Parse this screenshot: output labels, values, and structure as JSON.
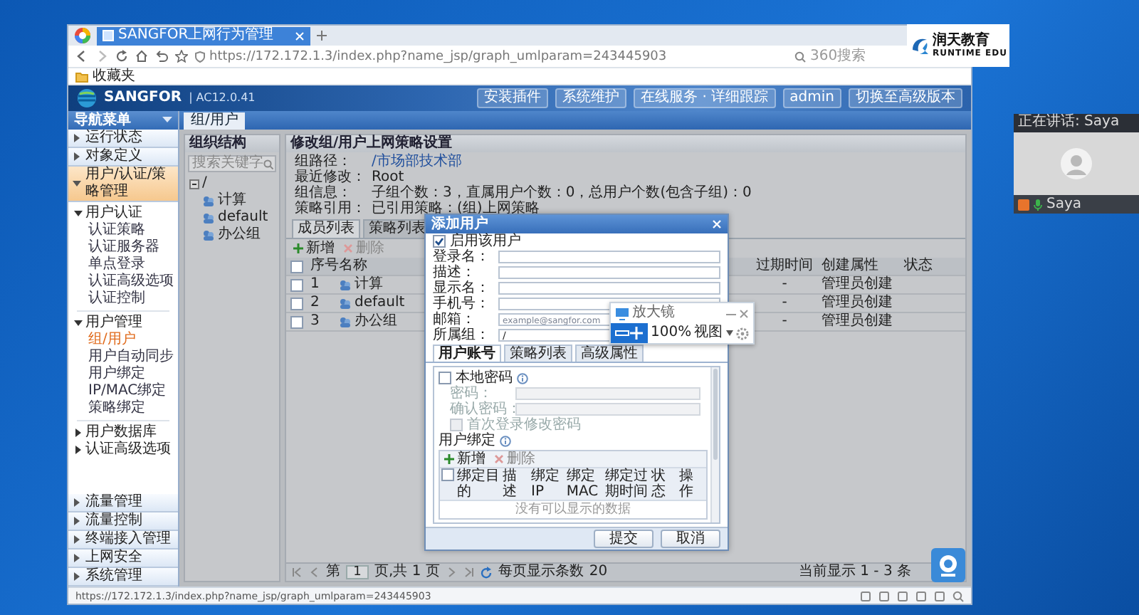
{
  "browser": {
    "tab_title": "SANGFOR上网行为管理",
    "url": "https://172.172.1.3/index.php?name_jsp/graph_umlparam=243445903",
    "search_placeholder": "360搜索",
    "bookmark": "收藏夹",
    "status_url": "https://172.172.1.3/index.php?name_jsp/graph_umlparam=243445903"
  },
  "app_header": {
    "brand": "SANGFOR",
    "version": "| AC12.0.41",
    "buttons": [
      "安装插件",
      "系统维护",
      "在线服务 · 详细跟踪",
      "admin",
      "切换至高级版本"
    ]
  },
  "nav": {
    "title": "导航菜单",
    "sections": [
      {
        "label": "运行状态",
        "expanded": false
      },
      {
        "label": "对象定义",
        "expanded": false
      },
      {
        "label": "用户/认证/策略管理",
        "expanded": true,
        "groups": [
          {
            "label": "用户认证",
            "expanded": true,
            "items": [
              {
                "label": "认证策略",
                "selected": false
              },
              {
                "label": "认证服务器",
                "selected": false
              },
              {
                "label": "单点登录",
                "selected": false
              },
              {
                "label": "认证高级选项",
                "selected": false
              },
              {
                "label": "认证控制",
                "selected": false
              }
            ]
          },
          {
            "label": "用户管理",
            "expanded": true,
            "items": [
              {
                "label": "组/用户",
                "selected": true
              },
              {
                "label": "用户自动同步",
                "selected": false
              },
              {
                "label": "用户绑定",
                "selected": false
              },
              {
                "label": "IP/MAC绑定",
                "selected": false
              },
              {
                "label": "策略绑定",
                "selected": false
              }
            ]
          },
          {
            "label": "用户数据库",
            "expanded": false
          },
          {
            "label": "认证高级选项",
            "expanded": false
          }
        ]
      },
      {
        "label": "流量管理",
        "expanded": false
      },
      {
        "label": "流量控制",
        "expanded": false
      },
      {
        "label": "终端接入管理",
        "expanded": false
      },
      {
        "label": "上网安全",
        "expanded": false
      },
      {
        "label": "系统管理",
        "expanded": false
      }
    ]
  },
  "page_tab": "组/用户",
  "org": {
    "title": "组织结构",
    "search_placeholder": "搜索关键字",
    "root": {
      "label": "/",
      "expanded": true,
      "children": [
        {
          "label": "计算"
        },
        {
          "label": "default"
        },
        {
          "label": "办公组"
        }
      ]
    }
  },
  "panel": {
    "title": "修改组/用户上网策略设置",
    "info": [
      {
        "label": "组路径：",
        "value": "/市场部技术部",
        "kind": "link"
      },
      {
        "label": "最近修改：",
        "value": "Root",
        "kind": "text"
      },
      {
        "label": "组信息：",
        "value": "子组个数：3，直属用户个数：0，总用户个数(包含子组)：0",
        "kind": "text"
      },
      {
        "label": "策略引用：",
        "value": "已引用策略：(组)上网策略",
        "kind": "text"
      }
    ],
    "tabs": [
      {
        "label": "成员列表",
        "selected": true
      },
      {
        "label": "策略列表",
        "selected": false
      }
    ],
    "toolbar": [
      {
        "label": "新增",
        "kind": "add",
        "disabled": false
      },
      {
        "label": "删除",
        "kind": "delete",
        "disabled": true
      }
    ],
    "select_all": false,
    "columns": [
      "序号",
      "名称",
      "过期时间",
      "创建属性",
      "状态"
    ],
    "rows": [
      {
        "index": "1",
        "name": "计算",
        "expiry": "-",
        "created_by": "管理员创建",
        "checked": false
      },
      {
        "index": "2",
        "name": "default",
        "expiry": "-",
        "created_by": "管理员创建",
        "checked": false
      },
      {
        "index": "3",
        "name": "办公组",
        "expiry": "-",
        "created_by": "管理员创建",
        "checked": false
      }
    ],
    "pager": {
      "page_label": "第",
      "page": "1",
      "page_total": "页,共 1 页",
      "per_page_label": "每页显示条数",
      "per_page": "20",
      "summary": "当前显示 1 - 3 条"
    }
  },
  "dialog": {
    "title": "添加用户",
    "enabled": {
      "label": "启用该用户",
      "checked": true
    },
    "fields": [
      {
        "label": "登录名："
      },
      {
        "label": "描述："
      },
      {
        "label": "显示名："
      },
      {
        "label": "手机号："
      },
      {
        "label": "邮箱：",
        "placeholder": "example@sangfor.com"
      },
      {
        "label": "所属组：",
        "value": "/"
      }
    ],
    "tabs": [
      {
        "label": "用户账号",
        "selected": true
      },
      {
        "label": "策略列表",
        "selected": false
      },
      {
        "label": "高级属性",
        "selected": false
      }
    ],
    "local_password": {
      "label": "本地密码",
      "checked": false
    },
    "password_fields": [
      {
        "label": "密码："
      },
      {
        "label": "确认密码："
      }
    ],
    "first_login": {
      "label": "首次登录修改密码",
      "checked": false
    },
    "binding": {
      "title": "用户绑定",
      "toolbar": [
        {
          "label": "新增",
          "kind": "add",
          "disabled": false
        },
        {
          "label": "删除",
          "kind": "delete",
          "disabled": true
        }
      ],
      "select_all": false,
      "columns": [
        "绑定目的",
        "描述",
        "绑定IP",
        "绑定MAC",
        "绑定过期时间",
        "状态",
        "操作"
      ],
      "empty_text": "没有可以显示的数据"
    },
    "buttons": [
      "提交",
      "取消"
    ]
  },
  "magnifier": {
    "title": "放大镜",
    "zoom": "100%",
    "view": "视图"
  },
  "meeting": {
    "speaking": "正在讲话: Saya",
    "participant": "Saya"
  },
  "logo": {
    "name": "润天教育",
    "subtitle": "RUNTIME EDU"
  }
}
